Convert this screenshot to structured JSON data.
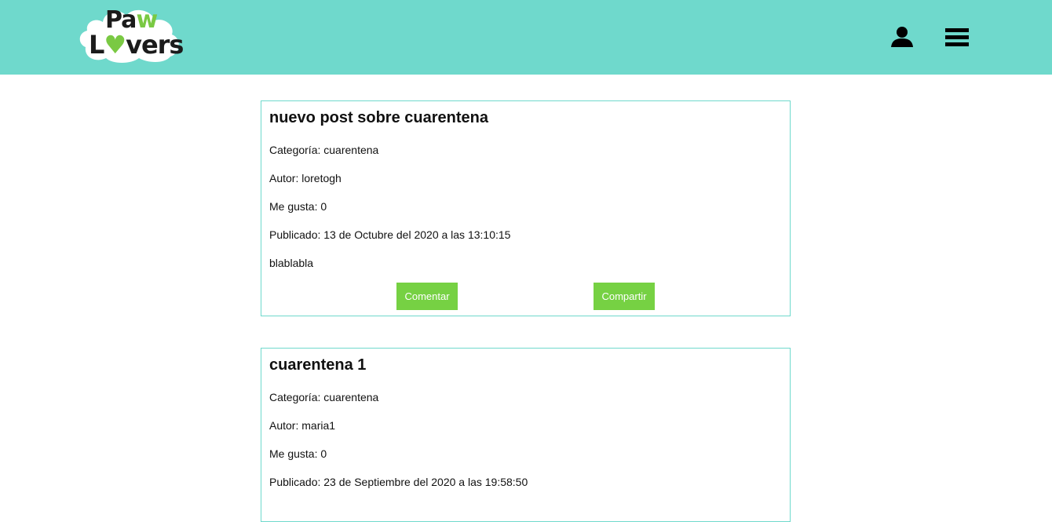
{
  "header": {
    "logo_text": {
      "paw_prefix": "Pa",
      "paw_suffix": "w",
      "lovers_l": "L",
      "lovers_rest": "vers"
    },
    "user_icon": "user-icon",
    "menu_icon": "menu-icon",
    "accent": "#6fd9cc"
  },
  "posts": [
    {
      "title": "nuevo post sobre cuarentena",
      "category": "Categoría: cuarentena",
      "author": "Autor: loretogh",
      "likes": "Me gusta: 0",
      "published": "Publicado: 13 de Octubre del 2020 a las 13:10:15",
      "body": "blablabla",
      "comment_label": "Comentar",
      "share_label": "Compartir"
    },
    {
      "title": "cuarentena 1",
      "category": "Categoría: cuarentena",
      "author": "Autor: maria1",
      "likes": "Me gusta: 0",
      "published": "Publicado: 23 de Septiembre del 2020 a las 19:58:50"
    }
  ],
  "colors": {
    "button": "#76d143",
    "border": "#6fd9cc"
  }
}
